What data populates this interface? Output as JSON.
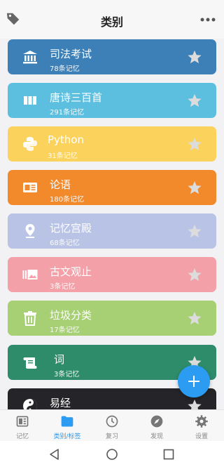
{
  "header": {
    "title": "类别",
    "left_icon": "tag-icon",
    "right_icon": "more-icon"
  },
  "categories": [
    {
      "name": "司法考试",
      "count": "78条记忆",
      "color": "#3d80b7",
      "icon": "bank-icon"
    },
    {
      "name": "唐诗三百首",
      "count": "291条记忆",
      "color": "#5cbfdf",
      "icon": "book-icon"
    },
    {
      "name": "Python",
      "count": "31条记忆",
      "color": "#fbd25c",
      "icon": "python-icon"
    },
    {
      "name": "论语",
      "count": "180条记忆",
      "color": "#f28a2b",
      "icon": "news-icon"
    },
    {
      "name": "记忆宫殿",
      "count": "68条记忆",
      "color": "#b8c3e6",
      "icon": "location-icon"
    },
    {
      "name": "古文观止",
      "count": "3条记忆",
      "color": "#f4a0a8",
      "icon": "gallery-icon"
    },
    {
      "name": "垃圾分类",
      "count": "17条记忆",
      "color": "#a7cf73",
      "icon": "trash-icon"
    },
    {
      "name": "词",
      "count": "3条记忆",
      "color": "#2e8c6b",
      "icon": "scroll-icon"
    },
    {
      "name": "易经",
      "count": "",
      "color": "#252529",
      "icon": "yin-yang-icon"
    }
  ],
  "fab": {
    "icon": "plus-icon"
  },
  "tabs": [
    {
      "label": "记忆",
      "icon": "memory-card-icon",
      "active": false
    },
    {
      "label": "类别/标签",
      "icon": "folder-icon",
      "active": true
    },
    {
      "label": "复习",
      "icon": "clock-icon",
      "active": false
    },
    {
      "label": "发现",
      "icon": "compass-icon",
      "active": false
    },
    {
      "label": "设置",
      "icon": "gear-icon",
      "active": false
    }
  ],
  "colors": {
    "accent": "#2b9cf2",
    "inactive": "#777777",
    "star": "#dcdcdc"
  }
}
